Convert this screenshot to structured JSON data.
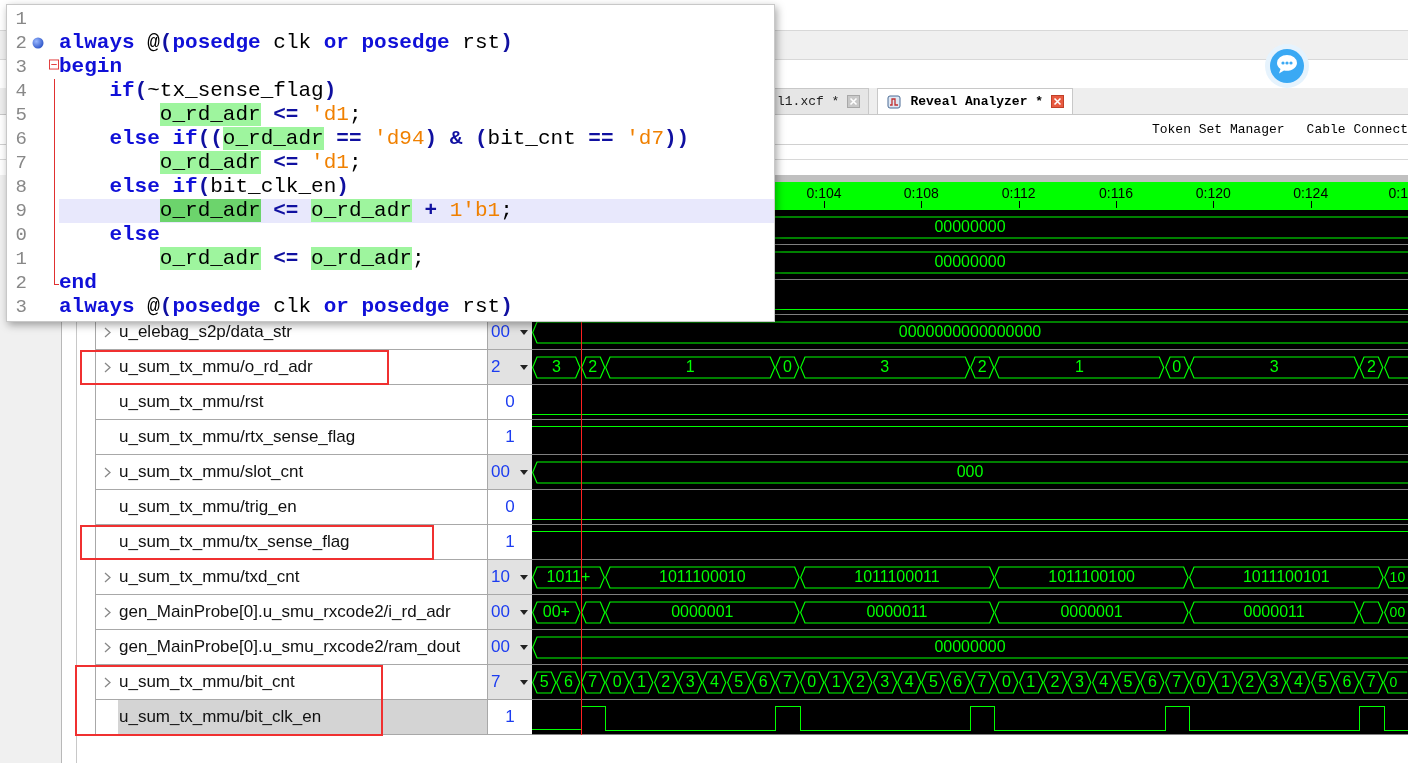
{
  "tabs": [
    {
      "label": "l1.xcf *",
      "selected": false
    },
    {
      "label": "Reveal Analyzer *",
      "selected": true
    }
  ],
  "toolbar": [
    "Token Set Manager",
    "Cable Connect"
  ],
  "timeline": {
    "ticks": [
      "0:104",
      "0:108",
      "0:112",
      "0:116",
      "0:120",
      "0:124",
      "0:1"
    ]
  },
  "cursor": {
    "kind": "two"
  },
  "signals": [
    {
      "kind": "bus",
      "segments": [
        {
          "label": "00000000",
          "kind": "rest"
        }
      ]
    },
    {
      "kind": "bus",
      "segments": [
        {
          "label": "00000000",
          "kind": "rest"
        }
      ]
    },
    {
      "kind": "bit",
      "segments": [
        {
          "high": false,
          "kind": "rest"
        }
      ]
    },
    {
      "kind": "bus",
      "name": "u_elebag_s2p/data_str",
      "value": "00",
      "expandable": true,
      "selected": false,
      "boxed": false,
      "segments": [
        {
          "label": "0000000000000000",
          "kind": "rest"
        }
      ]
    },
    {
      "kind": "bus",
      "name": "u_sum_tx_mmu/o_rd_adr",
      "value": "2",
      "expandable": true,
      "selected": false,
      "boxed": true,
      "box_continues": false,
      "segments": [
        {
          "label": "3",
          "kind": "two"
        },
        {
          "label": "2",
          "kind": "one"
        },
        {
          "label": "1",
          "kind": "seven"
        },
        {
          "label": "0",
          "kind": "one"
        },
        {
          "label": "3",
          "kind": "seven"
        },
        {
          "label": "2",
          "kind": "one"
        },
        {
          "label": "1",
          "kind": "seven"
        },
        {
          "label": "0",
          "kind": "one"
        },
        {
          "label": "3",
          "kind": "seven"
        },
        {
          "label": "2",
          "kind": "one"
        },
        {
          "kind": "rest"
        }
      ]
    },
    {
      "kind": "bit",
      "name": "u_sum_tx_mmu/rst",
      "value": "0",
      "expandable": false,
      "selected": false,
      "boxed": false,
      "segments": [
        {
          "high": false,
          "kind": "rest"
        }
      ]
    },
    {
      "kind": "bit",
      "name": "u_sum_tx_mmu/rtx_sense_flag",
      "value": "1",
      "expandable": false,
      "selected": false,
      "boxed": false,
      "segments": [
        {
          "high": true,
          "kind": "rest"
        }
      ]
    },
    {
      "kind": "bus",
      "name": "u_sum_tx_mmu/slot_cnt",
      "value": "00",
      "expandable": true,
      "selected": false,
      "boxed": false,
      "segments": [
        {
          "label": "000",
          "kind": "rest"
        }
      ]
    },
    {
      "kind": "bit",
      "name": "u_sum_tx_mmu/trig_en",
      "value": "0",
      "expandable": false,
      "selected": false,
      "boxed": false,
      "segments": [
        {
          "high": false,
          "kind": "rest"
        }
      ]
    },
    {
      "kind": "bit",
      "name": "u_sum_tx_mmu/tx_sense_flag",
      "value": "1",
      "expandable": false,
      "selected": false,
      "boxed": true,
      "box_continues": false,
      "segments": [
        {
          "high": true,
          "kind": "rest"
        }
      ]
    },
    {
      "kind": "bus",
      "name": "u_sum_tx_mmu/txd_cnt",
      "value": "10",
      "expandable": true,
      "selected": false,
      "boxed": false,
      "segments": [
        {
          "label": "1011+",
          "kind": "three"
        },
        {
          "label": "1011100010",
          "kind": "eight"
        },
        {
          "label": "1011100011",
          "kind": "eight"
        },
        {
          "label": "1011100100",
          "kind": "eight"
        },
        {
          "label": "1011100101",
          "kind": "eight"
        },
        {
          "label": "10",
          "kind": "rest"
        }
      ]
    },
    {
      "kind": "bus",
      "name": "gen_MainProbe[0].u_smu_rxcode2/i_rd_adr",
      "value": "00",
      "expandable": true,
      "selected": false,
      "boxed": false,
      "segments": [
        {
          "label": "00+",
          "kind": "two"
        },
        {
          "kind": "one"
        },
        {
          "label": "0000001",
          "kind": "eight"
        },
        {
          "label": "0000011",
          "kind": "eight"
        },
        {
          "label": "0000001",
          "kind": "eight"
        },
        {
          "label": "0000011",
          "kind": "seven"
        },
        {
          "kind": "one"
        },
        {
          "label": "00",
          "kind": "rest"
        }
      ]
    },
    {
      "kind": "bus",
      "name": "gen_MainProbe[0].u_smu_rxcode2/ram_dout",
      "value": "00",
      "expandable": true,
      "selected": false,
      "boxed": false,
      "segments": [
        {
          "label": "00000000",
          "kind": "rest"
        }
      ]
    },
    {
      "kind": "bus",
      "name": "u_sum_tx_mmu/bit_cnt",
      "value": "7",
      "expandable": true,
      "selected": false,
      "boxed": true,
      "box_continues": true,
      "segments": [
        {
          "label": "5",
          "kind": "one"
        },
        {
          "label": "6",
          "kind": "one"
        },
        {
          "label": "7",
          "kind": "one"
        },
        {
          "label": "0",
          "kind": "one"
        },
        {
          "label": "1",
          "kind": "one"
        },
        {
          "label": "2",
          "kind": "one"
        },
        {
          "label": "3",
          "kind": "one"
        },
        {
          "label": "4",
          "kind": "one"
        },
        {
          "label": "5",
          "kind": "one"
        },
        {
          "label": "6",
          "kind": "one"
        },
        {
          "label": "7",
          "kind": "one"
        },
        {
          "label": "0",
          "kind": "one"
        },
        {
          "label": "1",
          "kind": "one"
        },
        {
          "label": "2",
          "kind": "one"
        },
        {
          "label": "3",
          "kind": "one"
        },
        {
          "label": "4",
          "kind": "one"
        },
        {
          "label": "5",
          "kind": "one"
        },
        {
          "label": "6",
          "kind": "one"
        },
        {
          "label": "7",
          "kind": "one"
        },
        {
          "label": "0",
          "kind": "one"
        },
        {
          "label": "1",
          "kind": "one"
        },
        {
          "label": "2",
          "kind": "one"
        },
        {
          "label": "3",
          "kind": "one"
        },
        {
          "label": "4",
          "kind": "one"
        },
        {
          "label": "5",
          "kind": "one"
        },
        {
          "label": "6",
          "kind": "one"
        },
        {
          "label": "7",
          "kind": "one"
        },
        {
          "label": "0",
          "kind": "one"
        },
        {
          "label": "1",
          "kind": "one"
        },
        {
          "label": "2",
          "kind": "one"
        },
        {
          "label": "3",
          "kind": "one"
        },
        {
          "label": "4",
          "kind": "one"
        },
        {
          "label": "5",
          "kind": "one"
        },
        {
          "label": "6",
          "kind": "one"
        },
        {
          "label": "7",
          "kind": "one"
        },
        {
          "label": "0",
          "kind": "rest"
        }
      ]
    },
    {
      "kind": "bit",
      "name": "u_sum_tx_mmu/bit_clk_en",
      "value": "1",
      "expandable": false,
      "selected": true,
      "boxed": true,
      "box_continues": false,
      "segments": [
        {
          "high": false,
          "kind": "two"
        },
        {
          "high": true,
          "kind": "one"
        },
        {
          "high": false,
          "kind": "seven"
        },
        {
          "high": true,
          "kind": "one"
        },
        {
          "high": false,
          "kind": "seven"
        },
        {
          "high": true,
          "kind": "one"
        },
        {
          "high": false,
          "kind": "seven"
        },
        {
          "high": true,
          "kind": "one"
        },
        {
          "high": false,
          "kind": "seven"
        },
        {
          "high": true,
          "kind": "one"
        },
        {
          "high": false,
          "kind": "rest"
        }
      ]
    }
  ],
  "code_popup": {
    "lines": [
      {
        "number": "1",
        "kind": "plain",
        "breakpoint": false,
        "current": false
      },
      {
        "number": "2",
        "kind": "plain",
        "breakpoint": true,
        "current": false,
        "tokens": [
          {
            "text": "always",
            "kind": "kw"
          },
          {
            "text": " @",
            "kind": "plain"
          },
          {
            "text": "(",
            "kind": "op"
          },
          {
            "text": "posedge",
            "kind": "kw"
          },
          {
            "text": " clk ",
            "kind": "plain"
          },
          {
            "text": "or",
            "kind": "kw"
          },
          {
            "text": " posedge",
            "kind": "kw"
          },
          {
            "text": " rst",
            "kind": "plain"
          },
          {
            "text": ")",
            "kind": "op"
          }
        ]
      },
      {
        "number": "3",
        "kind": "fold-start",
        "breakpoint": false,
        "current": false,
        "tokens": [
          {
            "text": "begin",
            "kind": "kw"
          }
        ]
      },
      {
        "number": "4",
        "kind": "fold-inner",
        "breakpoint": false,
        "current": false,
        "tokens": [
          {
            "text": "    if",
            "kind": "kw"
          },
          {
            "text": "(",
            "kind": "op"
          },
          {
            "text": "~tx_sense_flag",
            "kind": "plain"
          },
          {
            "text": ")",
            "kind": "op"
          }
        ]
      },
      {
        "number": "5",
        "kind": "fold-inner",
        "breakpoint": false,
        "current": false,
        "tokens": [
          {
            "text": "        o_rd_adr",
            "kind": "match"
          },
          {
            "text": " <= ",
            "kind": "op"
          },
          {
            "text": "'d1",
            "kind": "num"
          },
          {
            "text": ";",
            "kind": "plain"
          }
        ]
      },
      {
        "number": "6",
        "kind": "fold-inner",
        "breakpoint": false,
        "current": false,
        "tokens": [
          {
            "text": "    else if",
            "kind": "kw"
          },
          {
            "text": "((",
            "kind": "op"
          },
          {
            "text": "o_rd_adr",
            "kind": "match"
          },
          {
            "text": " == ",
            "kind": "op"
          },
          {
            "text": "'d94",
            "kind": "num"
          },
          {
            "text": ") & (",
            "kind": "op"
          },
          {
            "text": "bit_cnt",
            "kind": "plain"
          },
          {
            "text": " == ",
            "kind": "op"
          },
          {
            "text": "'d7",
            "kind": "num"
          },
          {
            "text": "))",
            "kind": "op"
          }
        ]
      },
      {
        "number": "7",
        "kind": "fold-inner",
        "breakpoint": false,
        "current": false,
        "tokens": [
          {
            "text": "        o_rd_adr",
            "kind": "match"
          },
          {
            "text": " <= ",
            "kind": "op"
          },
          {
            "text": "'d1",
            "kind": "num"
          },
          {
            "text": ";",
            "kind": "plain"
          }
        ]
      },
      {
        "number": "8",
        "kind": "fold-inner",
        "breakpoint": false,
        "current": false,
        "tokens": [
          {
            "text": "    else if",
            "kind": "kw"
          },
          {
            "text": "(",
            "kind": "op"
          },
          {
            "text": "bit_clk_en",
            "kind": "plain"
          },
          {
            "text": ")",
            "kind": "op"
          }
        ]
      },
      {
        "number": "9",
        "kind": "fold-inner",
        "breakpoint": false,
        "current": true,
        "tokens": [
          {
            "text": "        o_rd_adr",
            "kind": "current-match"
          },
          {
            "text": " <= ",
            "kind": "op"
          },
          {
            "text": "o_rd_adr",
            "kind": "match"
          },
          {
            "text": " + ",
            "kind": "op"
          },
          {
            "text": "1'b1",
            "kind": "num"
          },
          {
            "text": ";",
            "kind": "plain"
          }
        ]
      },
      {
        "number": "0",
        "kind": "fold-inner",
        "breakpoint": false,
        "current": false,
        "tokens": [
          {
            "text": "    else",
            "kind": "kw"
          }
        ]
      },
      {
        "number": "1",
        "kind": "fold-inner",
        "breakpoint": false,
        "current": false,
        "tokens": [
          {
            "text": "        o_rd_adr",
            "kind": "match"
          },
          {
            "text": " <= ",
            "kind": "op"
          },
          {
            "text": "o_rd_adr",
            "kind": "match"
          },
          {
            "text": ";",
            "kind": "plain"
          }
        ]
      },
      {
        "number": "2",
        "kind": "fold-end",
        "breakpoint": false,
        "current": false,
        "tokens": [
          {
            "text": "end",
            "kind": "kw"
          }
        ]
      },
      {
        "number": "3",
        "kind": "plain",
        "breakpoint": false,
        "current": false,
        "tokens": [
          {
            "text": "always",
            "kind": "kw"
          },
          {
            "text": " @",
            "kind": "plain"
          },
          {
            "text": "(",
            "kind": "op"
          },
          {
            "text": "posedge",
            "kind": "kw"
          },
          {
            "text": " clk ",
            "kind": "plain"
          },
          {
            "text": "or",
            "kind": "kw"
          },
          {
            "text": " posedge",
            "kind": "kw"
          },
          {
            "text": " rst",
            "kind": "plain"
          },
          {
            "text": ")",
            "kind": "op"
          }
        ]
      }
    ]
  }
}
